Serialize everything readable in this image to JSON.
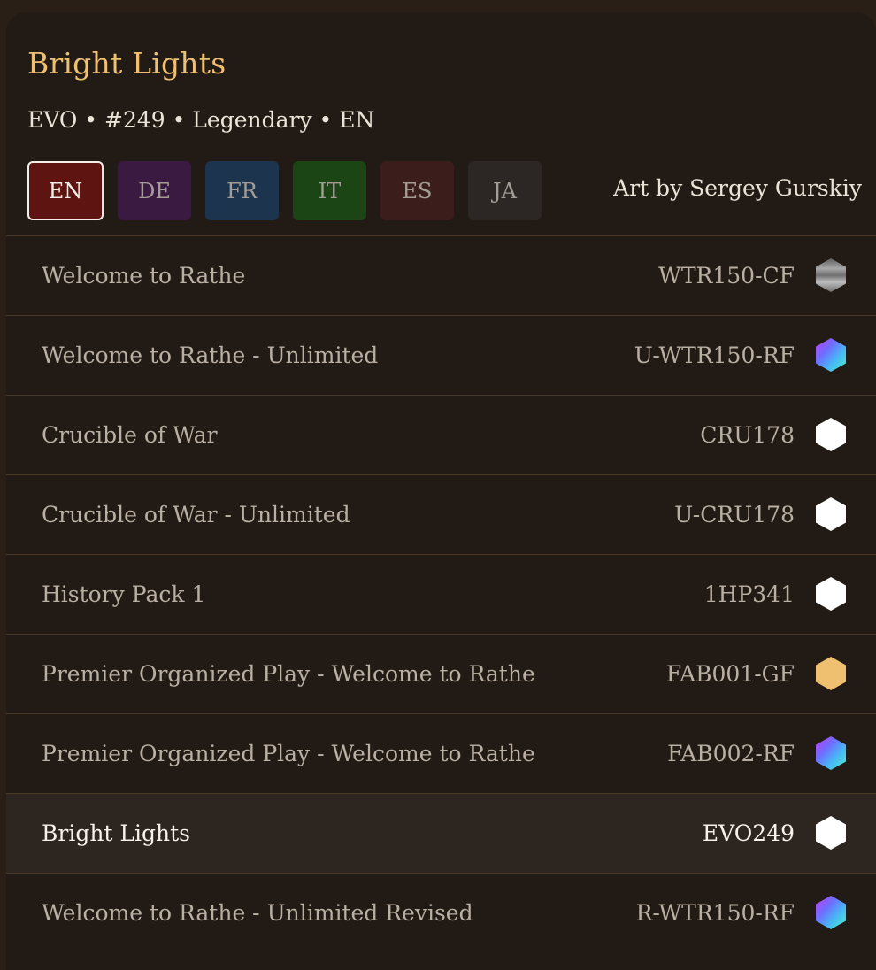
{
  "card": {
    "title": "Bright Lights",
    "subtitle": "EVO • #249 • Legendary • EN",
    "art_credit": "Art by Sergey Gurskiy"
  },
  "languages": [
    {
      "label": "EN",
      "color": "#5e1410",
      "active": true
    },
    {
      "label": "DE",
      "color": "#3a1a40",
      "active": false
    },
    {
      "label": "FR",
      "color": "#1d344f",
      "active": false
    },
    {
      "label": "IT",
      "color": "#1b4515",
      "active": false
    },
    {
      "label": "ES",
      "color": "#3b1e1b",
      "active": false
    },
    {
      "label": "JA",
      "color": "#2c2724",
      "active": false
    }
  ],
  "printings": [
    {
      "name": "Welcome to Rathe",
      "code": "WTR150-CF",
      "foil": "cold-foil-icon",
      "selected": false
    },
    {
      "name": "Welcome to Rathe - Unlimited",
      "code": "U-WTR150-RF",
      "foil": "rainbow-foil-icon",
      "selected": false
    },
    {
      "name": "Crucible of War",
      "code": "CRU178",
      "foil": "non-foil-icon",
      "selected": false
    },
    {
      "name": "Crucible of War - Unlimited",
      "code": "U-CRU178",
      "foil": "non-foil-icon",
      "selected": false
    },
    {
      "name": "History Pack 1",
      "code": "1HP341",
      "foil": "non-foil-icon",
      "selected": false
    },
    {
      "name": "Premier Organized Play - Welcome to Rathe",
      "code": "FAB001-GF",
      "foil": "gold-foil-icon",
      "selected": false
    },
    {
      "name": "Premier Organized Play - Welcome to Rathe",
      "code": "FAB002-RF",
      "foil": "rainbow-foil-icon",
      "selected": false
    },
    {
      "name": "Bright Lights",
      "code": "EVO249",
      "foil": "non-foil-icon",
      "selected": true
    },
    {
      "name": "Welcome to Rathe - Unlimited Revised",
      "code": "R-WTR150-RF",
      "foil": "rainbow-foil-icon",
      "selected": false
    }
  ],
  "colors": {
    "title": "#efbf72",
    "gold_foil": "#eec06f",
    "non_foil": "#ffffff"
  }
}
